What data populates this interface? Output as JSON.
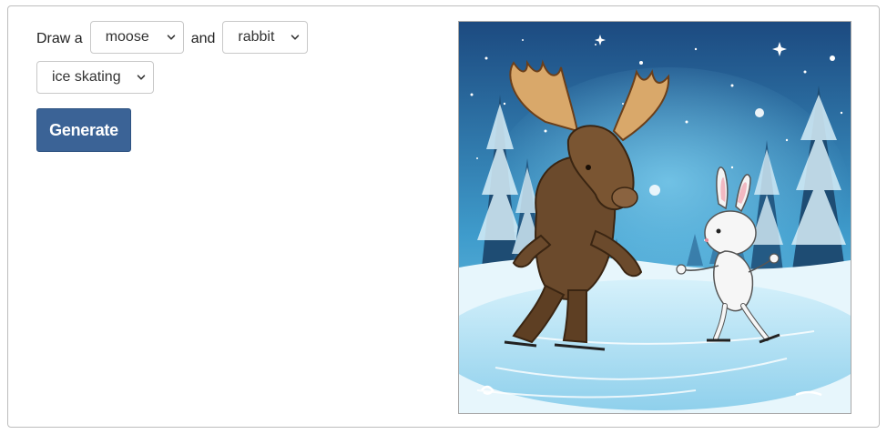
{
  "form": {
    "prefix_label": "Draw a",
    "animal1": {
      "selected": "moose"
    },
    "conjunction_label": "and",
    "animal2": {
      "selected": "rabbit"
    },
    "activity": {
      "selected": "ice skating"
    },
    "generate_label": "Generate"
  },
  "image": {
    "scene": "moose-and-rabbit-ice-skating",
    "colors": {
      "sky_top": "#1f4f86",
      "sky_bottom": "#49a9d6",
      "ice": "#bfe6f7",
      "moose": "#6b4a2c",
      "antler": "#d9a86a",
      "rabbit": "#f4f4f4"
    }
  }
}
